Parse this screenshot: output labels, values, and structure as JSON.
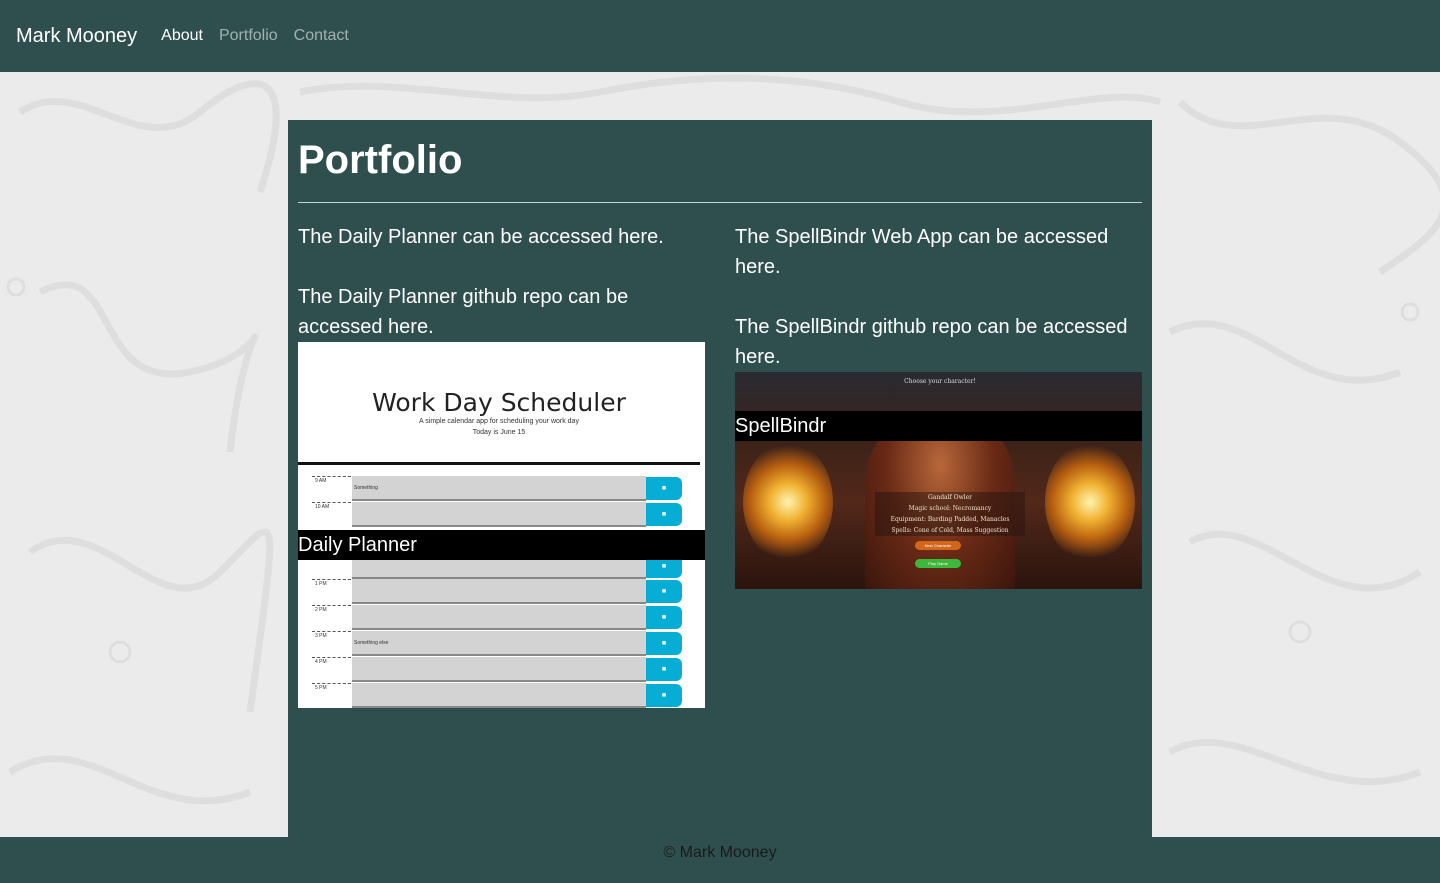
{
  "nav": {
    "brand": "Mark Mooney",
    "links": [
      {
        "label": "About"
      },
      {
        "label": "Portfolio"
      },
      {
        "label": "Contact"
      }
    ]
  },
  "main": {
    "title": "Portfolio",
    "projects": [
      {
        "app_text": "The Daily Planner can be accessed here.",
        "repo_text": "The Daily Planner github repo can be accessed here.",
        "label": "Daily Planner",
        "screenshot": {
          "title": "Work Day Scheduler",
          "subtitle": "A simple calendar app for scheduling your work day",
          "date": "Today is June 15",
          "rows": [
            {
              "hour": "9 AM",
              "text": "Something"
            },
            {
              "hour": "10 AM",
              "text": ""
            },
            {
              "hour": "1 PM",
              "text": ""
            },
            {
              "hour": "2 PM",
              "text": ""
            },
            {
              "hour": "3 PM",
              "text": "Something else"
            },
            {
              "hour": "4 PM",
              "text": ""
            },
            {
              "hour": "5 PM",
              "text": ""
            }
          ]
        }
      },
      {
        "app_text": "The SpellBindr Web App can be accessed here.",
        "repo_text": "The SpellBindr github repo can be accessed here.",
        "label": "SpellBindr",
        "screenshot": {
          "heading": "Choose your character!",
          "lines": [
            "Gandalf Owler",
            "Magic school: Necromancy",
            "Equipment: Barding Padded, Manacles",
            "Spells: Cone of Cold, Mass Suggestion"
          ],
          "new_button": "New Character",
          "play_button": "Play Game"
        }
      }
    ]
  },
  "footer": {
    "text": "© Mark Mooney"
  }
}
